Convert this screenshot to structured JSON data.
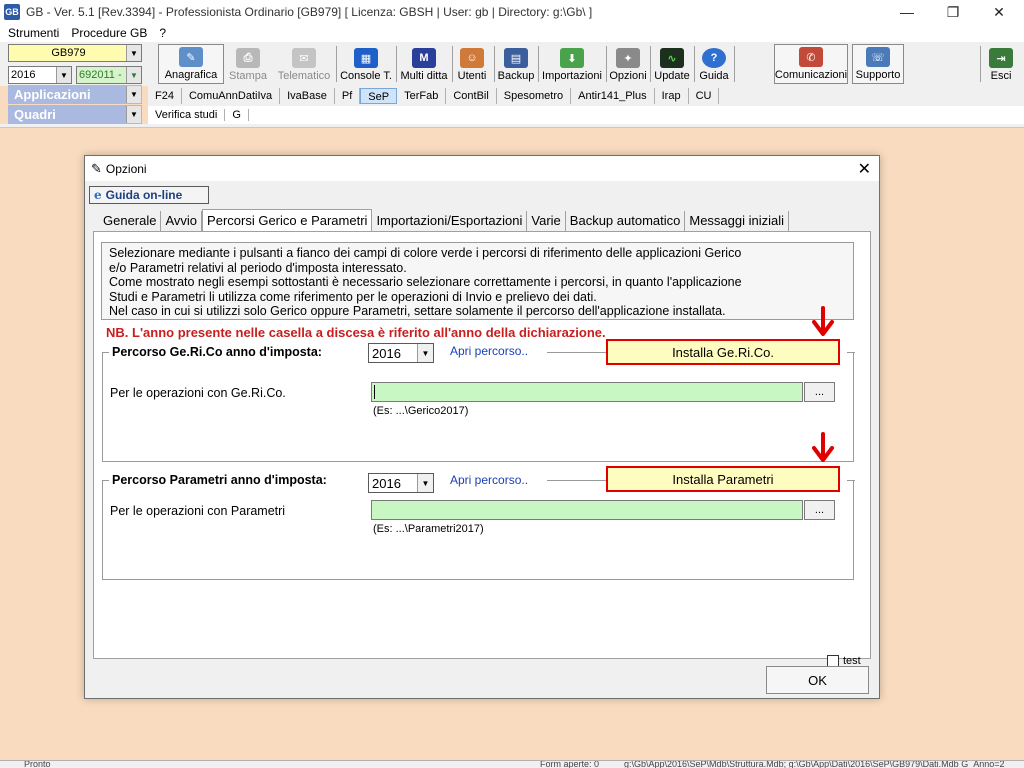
{
  "window": {
    "logo_text": "GB",
    "title": "GB - Ver. 5.1 [Rev.3394] -  Professionista Ordinario [GB979]    [ Licenza: GBSH | User: gb | Directory: g:\\Gb\\ ]",
    "minimize_glyph": "—",
    "maximize_glyph": "❐",
    "close_glyph": "✕"
  },
  "menu": [
    "Strumenti",
    "Procedure GB",
    "?"
  ],
  "selectors": {
    "company": "GB979",
    "year": "2016",
    "code": "692011 -",
    "applicazioni": "Applicazioni",
    "quadri": "Quadri"
  },
  "toolbar": {
    "anagrafica": "Anagrafica",
    "stampa": "Stampa",
    "telematico": "Telematico",
    "console": "Console T.",
    "multiditta": "Multi ditta",
    "utenti": "Utenti",
    "backup": "Backup",
    "importazioni": "Importazioni",
    "opzioni": "Opzioni",
    "update": "Update",
    "guida": "Guida",
    "comunicazioni": "Comunicazioni",
    "supporto": "Supporto",
    "esci": "Esci",
    "multiditta_icon_letter": "M",
    "guida_icon_letter": "?"
  },
  "app_tabs": [
    "F24",
    "ComuAnnDatiIva",
    "IvaBase",
    "Pf",
    "SeP",
    "TerFab",
    "ContBil",
    "Spesometro",
    "Antir141_Plus",
    "Irap",
    "CU"
  ],
  "quadri_tabs": [
    "Verifica studi",
    "G"
  ],
  "statusbar": {
    "status": "Pronto",
    "forms": "Form aperte: 0",
    "path": "g:\\Gb\\App\\2016\\SeP\\Mdb\\Struttura.Mdb; g:\\Gb\\App\\Dati\\2016\\SeP\\GB979\\Dati.Mdb G_Anno=2"
  },
  "dialog": {
    "title": "Opzioni",
    "close_glyph": "✕",
    "help_icon_letter": "e",
    "help_button": "Guida on-line",
    "tabs": [
      "Generale",
      "Avvio",
      "Percorsi Gerico e Parametri",
      "Importazioni/Esportazioni",
      "Varie",
      "Backup automatico",
      "Messaggi iniziali"
    ],
    "description": [
      "Selezionare mediante i pulsanti a fianco dei campi di colore verde i percorsi di riferimento delle applicazioni Gerico",
      "e/o Parametri relativi al periodo d'imposta interessato.",
      "Come mostrato negli esempi sottostanti è necessario selezionare correttamente i percorsi, in quanto l'applicazione",
      "Studi e Parametri li utilizza come riferimento per le operazioni di Invio e prelievo dei dati.",
      "Nel caso in cui si utilizzi solo Gerico oppure Parametri, settare solamente il percorso dell'applicazione installata."
    ],
    "nb_note": "NB. L'anno presente nelle casella a discesa è riferito all'anno della dichiarazione.",
    "gerico": {
      "label": "Percorso Ge.Ri.Co anno d'imposta:",
      "year": "2016",
      "open_link": "Apri percorso..",
      "install_button": "Installa Ge.Ri.Co.",
      "row_label": "Per le operazioni con Ge.Ri.Co.",
      "path_value": "",
      "browse": "...",
      "example": "(Es: ...\\Gerico2017)"
    },
    "parametri": {
      "label": "Percorso Parametri anno d'imposta:",
      "year": "2016",
      "open_link": "Apri percorso..",
      "install_button": "Installa Parametri",
      "row_label": "Per le operazioni con Parametri",
      "path_value": "",
      "browse": "...",
      "example": "(Es: ...\\Parametri2017)"
    },
    "test_label": "test",
    "ok_button": "OK"
  },
  "colors": {
    "workspace_bg": "#f9dcbf",
    "install_border": "#e00000",
    "install_bg": "#fffcc0",
    "path_field_bg": "#c9f7c3",
    "nb_text": "#c81e1e",
    "link": "#1a3fb8",
    "category_bar": "#a9b9e0"
  }
}
